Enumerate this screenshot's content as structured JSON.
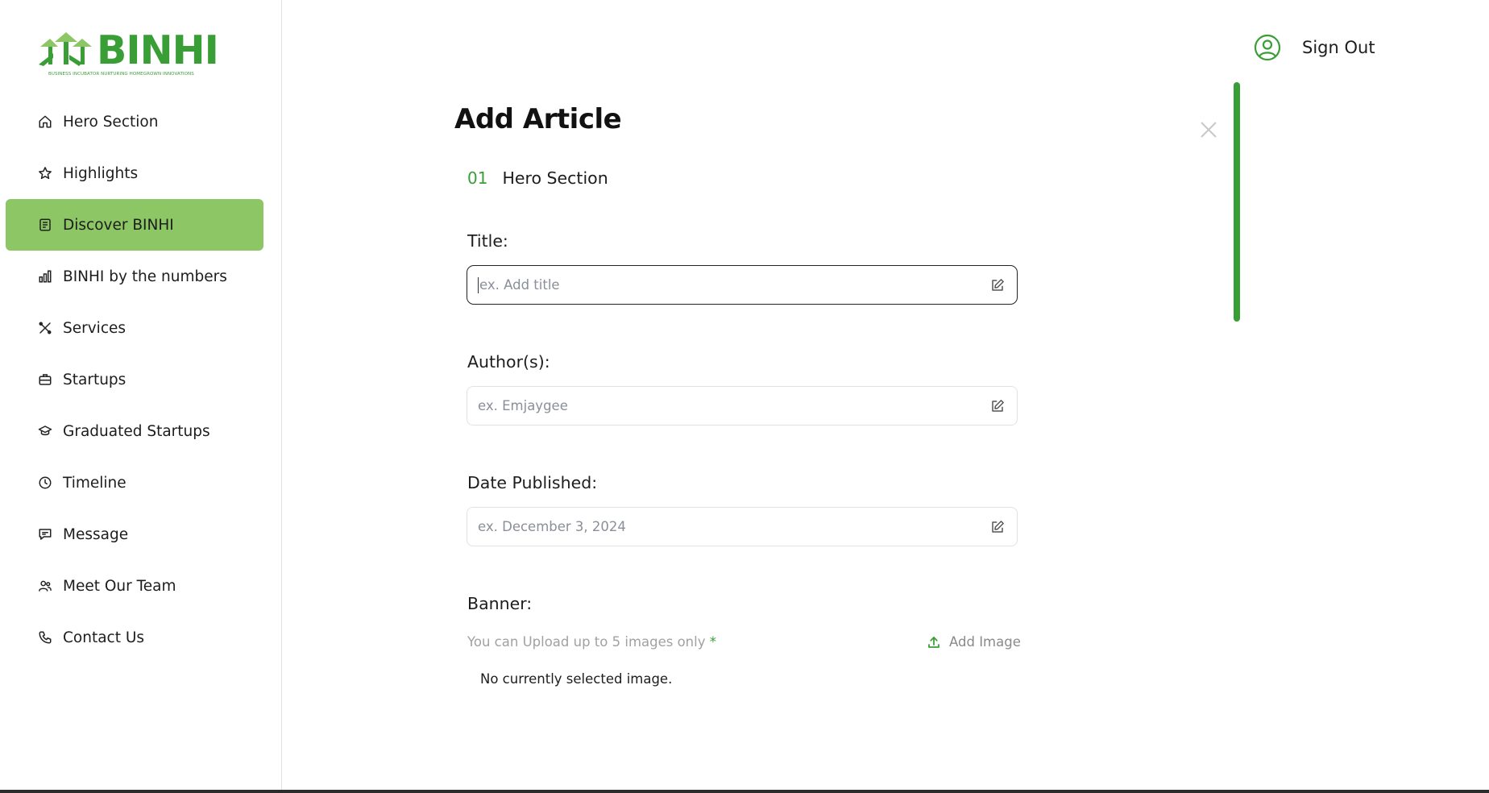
{
  "brand": {
    "name": "BINHI",
    "tagline": "BUSINESS INCUBATOR NURTURING HOMEGROWN INNOVATIONS",
    "color": "#3a9e36",
    "active_color": "#8dc665"
  },
  "sidebar": {
    "items": [
      {
        "label": "Hero Section",
        "icon": "home-icon"
      },
      {
        "label": "Highlights",
        "icon": "star-icon"
      },
      {
        "label": "Discover BINHI",
        "icon": "newspaper-icon",
        "active": true
      },
      {
        "label": "BINHI by the numbers",
        "icon": "bar-chart-icon"
      },
      {
        "label": "Services",
        "icon": "tools-icon"
      },
      {
        "label": "Startups",
        "icon": "briefcase-icon"
      },
      {
        "label": "Graduated Startups",
        "icon": "graduation-cap-icon"
      },
      {
        "label": "Timeline",
        "icon": "clock-icon"
      },
      {
        "label": "Message",
        "icon": "message-icon"
      },
      {
        "label": "Meet Our Team",
        "icon": "team-icon"
      },
      {
        "label": "Contact Us",
        "icon": "phone-icon"
      }
    ]
  },
  "header": {
    "signout_label": "Sign Out",
    "signout_icon": "user-circle-icon"
  },
  "form": {
    "title": "Add Article",
    "section_number": "01",
    "section_name": "Hero Section",
    "fields": {
      "title": {
        "label": "Title:",
        "placeholder": "ex. Add title",
        "value": ""
      },
      "authors": {
        "label": "Author(s):",
        "placeholder": "ex. Emjaygee",
        "value": ""
      },
      "date": {
        "label": "Date Published:",
        "placeholder": "ex. December 3, 2024",
        "value": ""
      }
    },
    "banner": {
      "label": "Banner:",
      "hint": "You can Upload up to 5 images only",
      "required_mark": "*",
      "add_label": "Add Image",
      "empty_text": "No currently selected image."
    }
  }
}
